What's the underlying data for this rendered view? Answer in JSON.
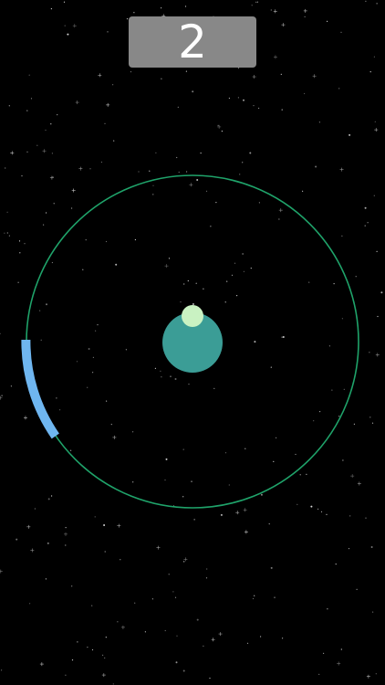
{
  "score": {
    "value": "2"
  },
  "colors": {
    "background": "#000000",
    "score_box": "#888888",
    "score_text": "#ffffff",
    "orbit": "#1fa36a",
    "planet": "#3b9d96",
    "moon": "#c9f2c2",
    "paddle": "#6fb6f0",
    "star": "#ffffff"
  },
  "icons": {
    "planet": "planet-icon",
    "moon": "moon-icon",
    "paddle": "paddle-arc"
  }
}
